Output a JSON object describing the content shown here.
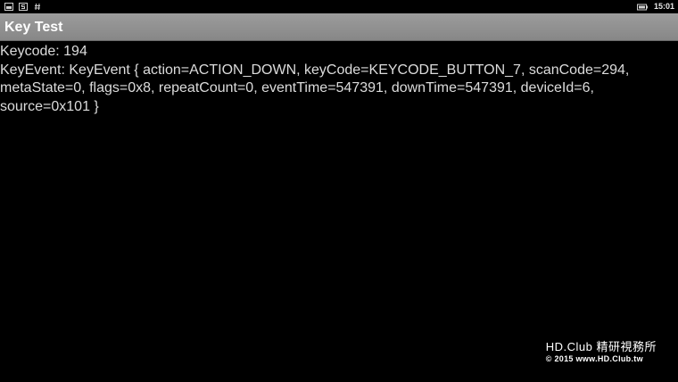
{
  "status_bar": {
    "time": "15:01",
    "icons": [
      "screenshot-notification-icon",
      "s-notification-icon",
      "hash-notification-icon",
      "battery-icon"
    ]
  },
  "action_bar": {
    "title": "Key Test"
  },
  "content": {
    "keycode_line": "Keycode: 194",
    "keyevent_line": "KeyEvent: KeyEvent { action=ACTION_DOWN, keyCode=KEYCODE_BUTTON_7, scanCode=294, metaState=0, flags=0x8, repeatCount=0, eventTime=547391, downTime=547391, deviceId=6, source=0x101 }"
  },
  "watermark": {
    "line1": "HD.Club 精研視務所",
    "line2": "© 2015  www.HD.Club.tw"
  },
  "colors": {
    "background": "#000000",
    "action_bar": "#8f8f8f",
    "text": "#dcdcdc"
  }
}
